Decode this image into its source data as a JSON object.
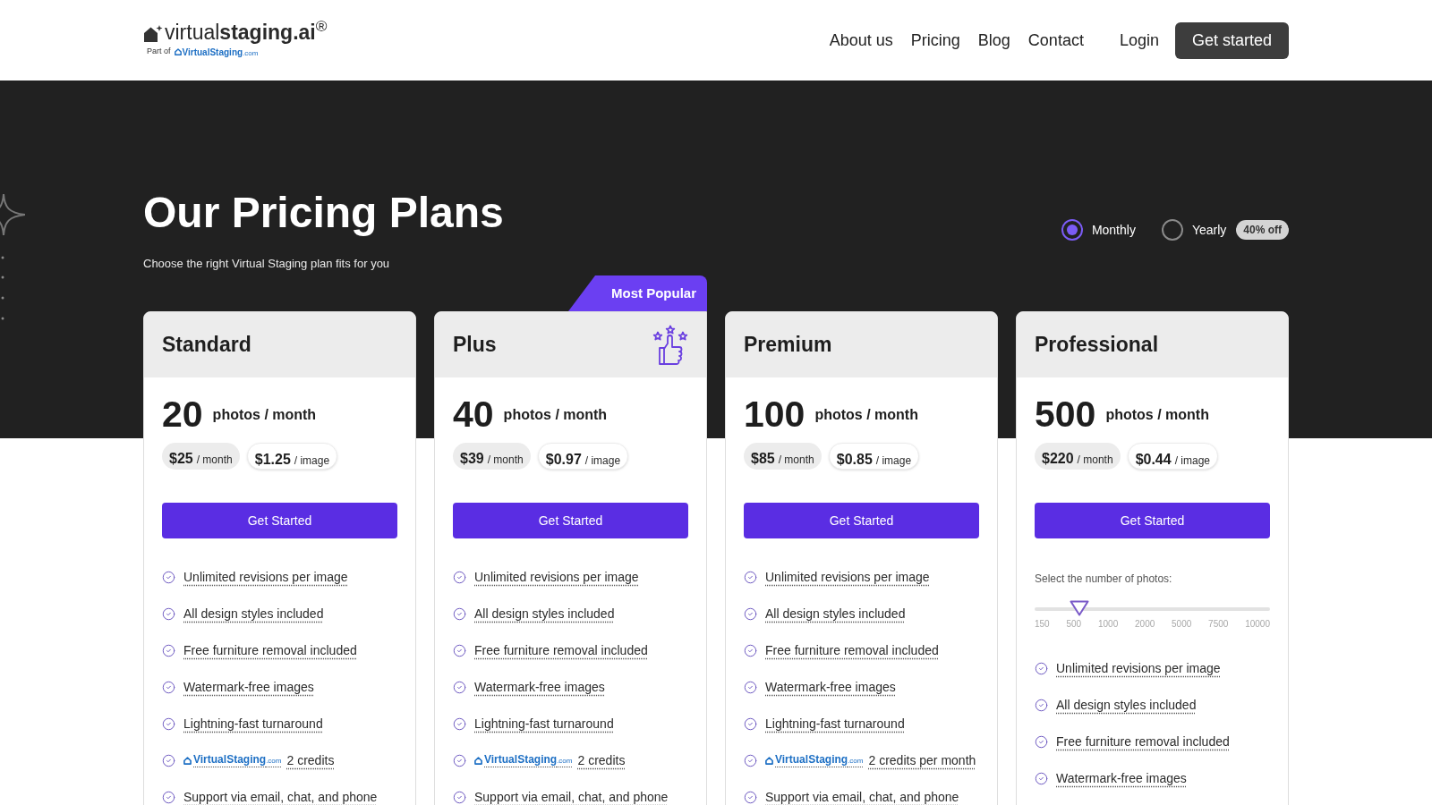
{
  "header": {
    "logo": {
      "wordmark": "virtual**staging.ai**$^{®}$",
      "tagline": "Part of",
      "parent_brand": "VirtualStaging",
      "parent_suffix": ".com"
    },
    "nav": [
      {
        "label": "About us"
      },
      {
        "label": "Pricing"
      },
      {
        "label": "Blog"
      },
      {
        "label": "Contact"
      }
    ],
    "login": "Login",
    "cta": "Get started"
  },
  "hero": {
    "title": "Our Pricing Plans",
    "subtitle": "Choose the right Virtual Staging plan fits for you",
    "billing": [
      {
        "label": "Monthly",
        "selected": true
      },
      {
        "label": "Yearly",
        "selected": false,
        "badge": "40% off"
      }
    ]
  },
  "plans": [
    {
      "name": "Standard",
      "featured": false,
      "count": "20",
      "unit": "photos / month",
      "prices": [
        {
          "amount": "$25",
          "per": "/ month"
        },
        {
          "amount": "$1.25",
          "per": "/ image"
        }
      ],
      "button": "Get Started",
      "features": [
        {
          "kind": "text",
          "text": "Unlimited revisions per image"
        },
        {
          "kind": "text",
          "text": "All design styles included"
        },
        {
          "kind": "text",
          "text": "Free furniture removal included"
        },
        {
          "kind": "text",
          "text": "Watermark-free images"
        },
        {
          "kind": "text",
          "text": "Lightning-fast turnaround"
        },
        {
          "kind": "credits",
          "brand": "VirtualStaging",
          "suffix": ".com",
          "text": "2 credits"
        },
        {
          "kind": "text",
          "text": "Support via email, chat, and phone"
        }
      ]
    },
    {
      "name": "Plus",
      "featured": true,
      "ribbon": "Most Popular",
      "count": "40",
      "unit": "photos / month",
      "prices": [
        {
          "amount": "$39",
          "per": "/ month"
        },
        {
          "amount": "$0.97",
          "per": "/ image"
        }
      ],
      "button": "Get Started",
      "features": [
        {
          "kind": "text",
          "text": "Unlimited revisions per image"
        },
        {
          "kind": "text",
          "text": "All design styles included"
        },
        {
          "kind": "text",
          "text": "Free furniture removal included"
        },
        {
          "kind": "text",
          "text": "Watermark-free images"
        },
        {
          "kind": "text",
          "text": "Lightning-fast turnaround"
        },
        {
          "kind": "credits",
          "brand": "VirtualStaging",
          "suffix": ".com",
          "text": "2 credits"
        },
        {
          "kind": "text",
          "text": "Support via email, chat, and phone"
        }
      ]
    },
    {
      "name": "Premium",
      "featured": false,
      "count": "100",
      "unit": "photos / month",
      "prices": [
        {
          "amount": "$85",
          "per": "/ month"
        },
        {
          "amount": "$0.85",
          "per": "/ image"
        }
      ],
      "button": "Get Started",
      "features": [
        {
          "kind": "text",
          "text": "Unlimited revisions per image"
        },
        {
          "kind": "text",
          "text": "All design styles included"
        },
        {
          "kind": "text",
          "text": "Free furniture removal included"
        },
        {
          "kind": "text",
          "text": "Watermark-free images"
        },
        {
          "kind": "text",
          "text": "Lightning-fast turnaround"
        },
        {
          "kind": "credits",
          "brand": "VirtualStaging",
          "suffix": ".com",
          "text": "2 credits per month"
        },
        {
          "kind": "text",
          "text": "Support via email, chat, and phone"
        }
      ]
    },
    {
      "name": "Professional",
      "featured": false,
      "count": "500",
      "unit": "photos / month",
      "prices": [
        {
          "amount": "$220",
          "per": "/ month"
        },
        {
          "amount": "$0.44",
          "per": "/ image"
        }
      ],
      "button": "Get Started",
      "slider": {
        "label": "Select the number of photos:",
        "ticks": [
          "150",
          "500",
          "1000",
          "2000",
          "5000",
          "7500",
          "10000"
        ],
        "level": 0.19
      },
      "features": [
        {
          "kind": "text",
          "text": "Unlimited revisions per image"
        },
        {
          "kind": "text",
          "text": "All design styles included"
        },
        {
          "kind": "text",
          "text": "Free furniture removal included"
        },
        {
          "kind": "text",
          "text": "Watermark-free images"
        }
      ]
    }
  ]
}
